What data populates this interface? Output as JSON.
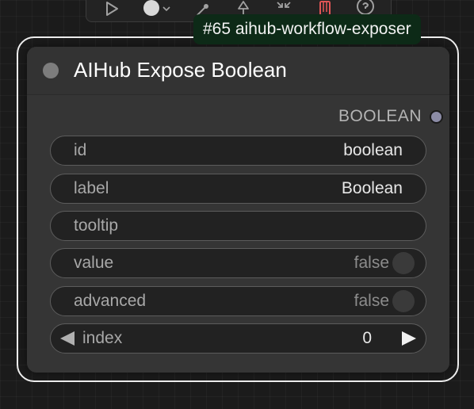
{
  "toolbar": {
    "icons": [
      "play-icon",
      "color-circle-icon",
      "chevron-down-icon",
      "magic-wand-icon",
      "pin-icon",
      "collapse-icon",
      "trash-icon",
      "help-icon"
    ],
    "colors": {
      "icon": "#a0a0a0",
      "danger": "#e05555"
    }
  },
  "node": {
    "badge": "#65 aihub-workflow-exposer",
    "title": "AIHub Expose Boolean",
    "output_label": "BOOLEAN",
    "widgets": {
      "id": {
        "label": "id",
        "value": "boolean"
      },
      "label": {
        "label": "label",
        "value": "Boolean"
      },
      "tooltip": {
        "label": "tooltip",
        "value": ""
      },
      "value": {
        "label": "value",
        "value": "false"
      },
      "advanced": {
        "label": "advanced",
        "value": "false"
      },
      "index": {
        "label": "index",
        "value": "0"
      }
    },
    "colors": {
      "badge_bg": "#0d2a17",
      "body_bg": "#353535",
      "slot": "#8c8ca6"
    }
  }
}
